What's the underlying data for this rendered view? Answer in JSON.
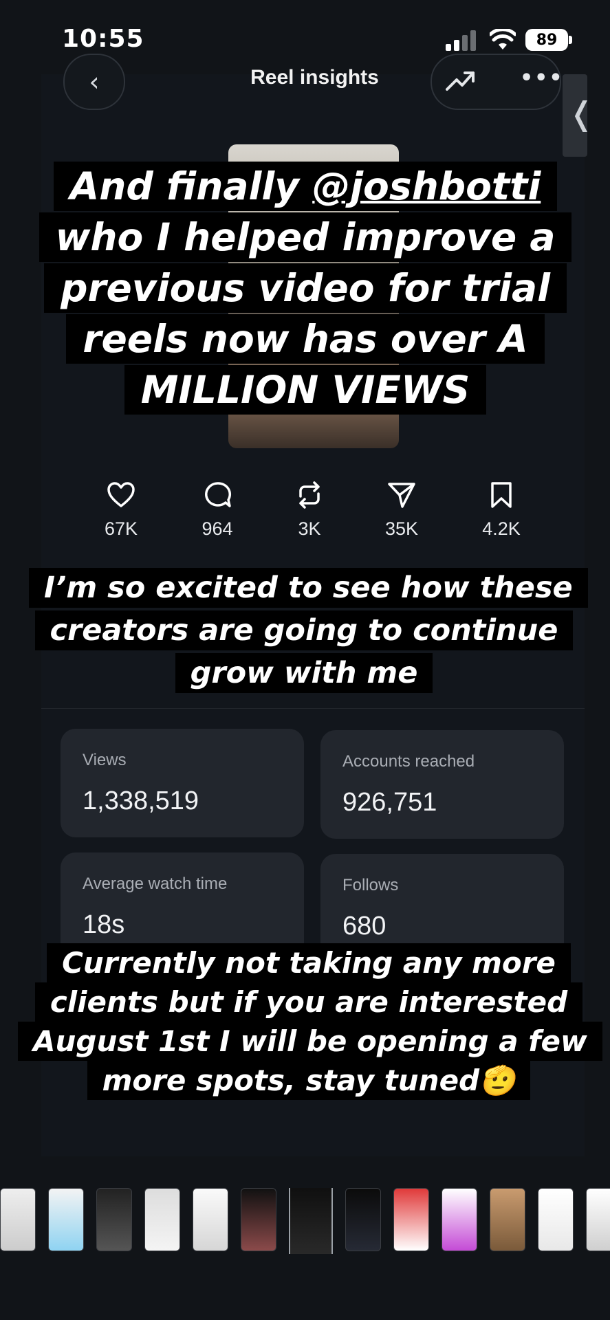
{
  "status_bar": {
    "time": "10:55",
    "battery": "89"
  },
  "header": {
    "title": "Reel insights"
  },
  "stats": [
    {
      "icon": "heart-icon",
      "value": "67K"
    },
    {
      "icon": "comment-icon",
      "value": "964"
    },
    {
      "icon": "repost-icon",
      "value": "3K"
    },
    {
      "icon": "share-icon",
      "value": "35K"
    },
    {
      "icon": "bookmark-icon",
      "value": "4.2K"
    }
  ],
  "cards": {
    "views": {
      "label": "Views",
      "value": "1,338,519"
    },
    "accounts_reached": {
      "label": "Accounts reached",
      "value": "926,751"
    },
    "avg_watch_time": {
      "label": "Average watch time",
      "value": "18s"
    },
    "follows": {
      "label": "Follows",
      "value": "680"
    }
  },
  "captions": {
    "first_pre": "And finally ",
    "first_mention": "@joshbotti",
    "first_post": " who I helped improve a previous video for trial reels now has over A MILLION VIEWS",
    "second": "I’m so excited to see how these creators are going to continue grow with me",
    "third": "Currently not taking any more clients but if you are interested August 1st I will be opening a few more spots, stay tuned🫡"
  },
  "colors": {
    "background": "#111418",
    "card": "#22262d",
    "caption_bg": "#000000"
  }
}
